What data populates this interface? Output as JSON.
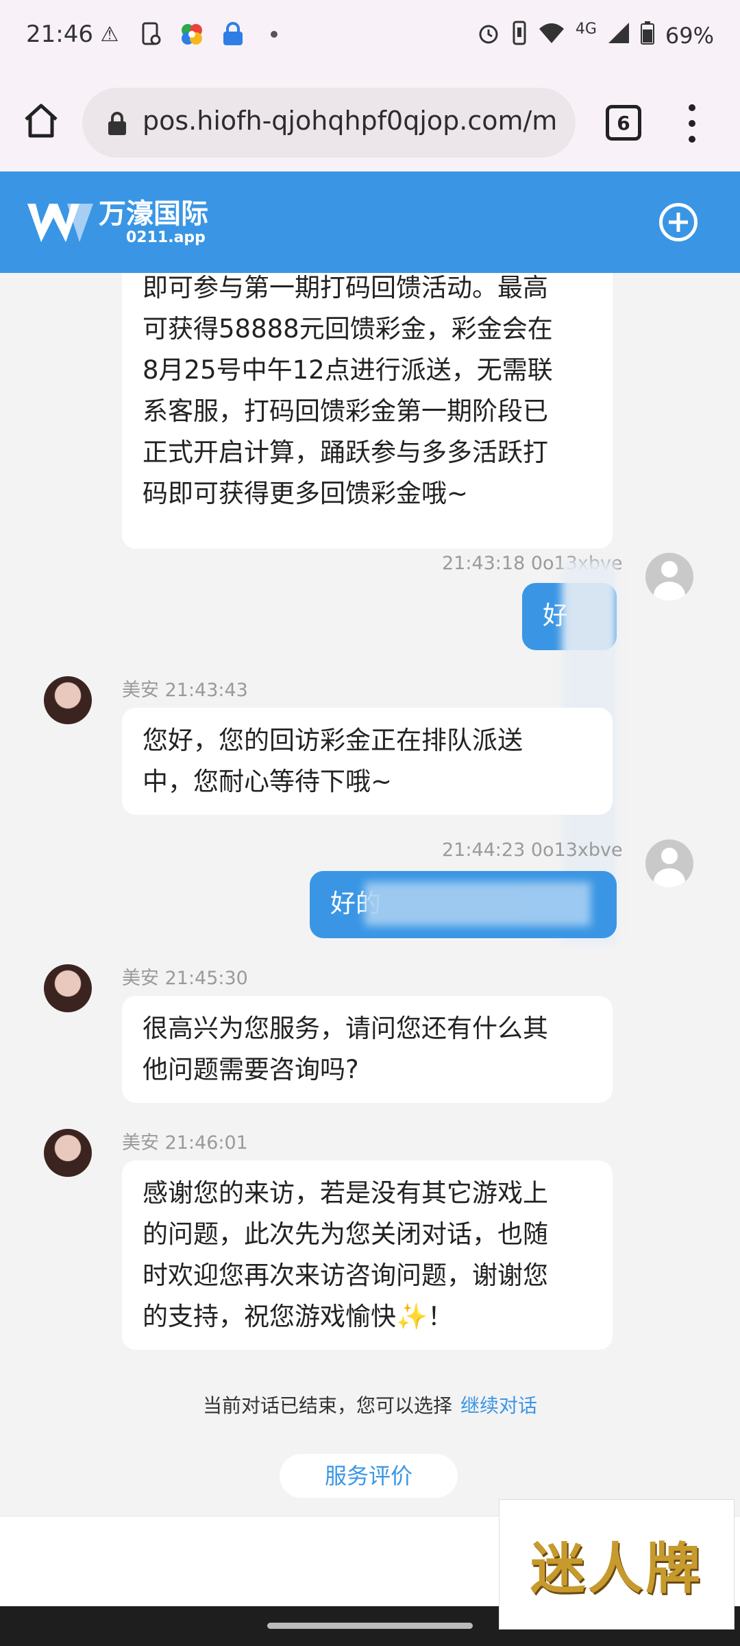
{
  "status_bar": {
    "time": "21:46",
    "network": "4G",
    "battery": "69%",
    "left_icons": [
      "warning-icon",
      "phone-sync-icon",
      "colorful-app-icon",
      "lock-app-icon",
      "dot-icon"
    ],
    "right_icons": [
      "alarm-icon",
      "vibrate-icon",
      "wifi-icon",
      "signal-icon",
      "battery-icon"
    ]
  },
  "browser": {
    "url": "pos.hiofh-qjohqhpf0qjop.com/m",
    "tab_count": "6"
  },
  "site": {
    "brand_name": "万濠国际",
    "brand_domain": "0211.app"
  },
  "messages": [
    {
      "side": "agent",
      "text_lines": [
        "即可参与第一期打码回馈活动。最高",
        "可获得58888元回馈彩金，彩金会在",
        "8月25号中午12点进行派送，无需联",
        "系客服，打码回馈彩金第一期阶段已",
        "正式开启计算，踊跃参与多多活跃打",
        "码即可获得更多回馈彩金哦~"
      ]
    },
    {
      "side": "user",
      "meta": "21:43:18 0o13xbve",
      "text": "好"
    },
    {
      "side": "agent",
      "meta": "美安 21:43:43",
      "text_lines": [
        "您好，您的回访彩金正在排队派送",
        "中，您耐心等待下哦~"
      ]
    },
    {
      "side": "user",
      "meta": "21:44:23 0o13xbve",
      "text": "好的"
    },
    {
      "side": "agent",
      "meta": "美安 21:45:30",
      "text_lines": [
        "很高兴为您服务，请问您还有什么其",
        "他问题需要咨询吗?"
      ]
    },
    {
      "side": "agent",
      "meta": "美安 21:46:01",
      "text_lines": [
        "感谢您的来访，若是没有其它游戏上",
        "的问题，此次先为您关闭对话，也随",
        "时欢迎您再次来访咨询问题，谢谢您",
        "的支持，祝您游戏愉快✨！"
      ]
    }
  ],
  "footer": {
    "ended_text": "当前对话已结束，您可以选择",
    "continue_link": "继续对话",
    "rate_button": "服务评价"
  },
  "watermark": "迷人牌"
}
